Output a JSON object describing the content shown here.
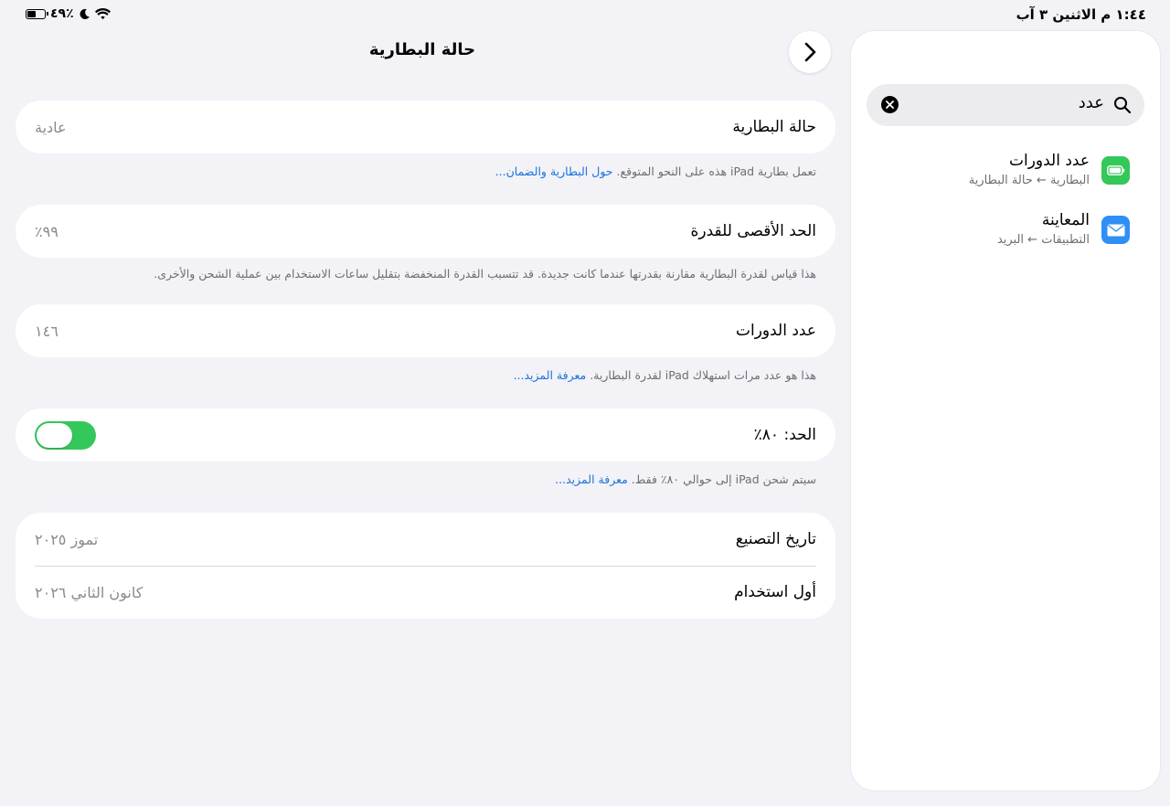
{
  "status_bar": {
    "time_date": "١:٤٤ م   الاثنين ٣ آب",
    "battery_percent": "٤٩٪"
  },
  "detail": {
    "title": "حالة البطارية",
    "battery_health": {
      "label": "حالة البطارية",
      "value": "عادية",
      "footnote": "تعمل بطارية iPad هذه على النحو المتوقع.",
      "footnote_link": "حول البطارية والضمان..."
    },
    "max_capacity": {
      "label": "الحد الأقصى للقدرة",
      "value": "٩٩٪",
      "footnote": "هذا قياس لقدرة البطارية مقارنة بقدرتها عندما كانت جديدة. قد تتسبب القدرة المنخفضة بتقليل ساعات الاستخدام بين عملية الشحن والأخرى."
    },
    "cycle_count": {
      "label": "عدد الدورات",
      "value": "١٤٦",
      "footnote": "هذا هو عدد مرات استهلاك iPad لقدرة البطارية.",
      "footnote_link": "معرفة المزيد..."
    },
    "limit": {
      "label": "الحد: ٨٠٪",
      "toggle_on": true,
      "footnote": "سيتم شحن iPad إلى حوالي ٨٠٪ فقط.",
      "footnote_link": "معرفة المزيد..."
    },
    "manufacture_date": {
      "label": "تاريخ التصنيع",
      "value": "تموز ٢٠٢٥"
    },
    "first_use": {
      "label": "أول استخدام",
      "value": "كانون الثاني ٢٠٢٦"
    }
  },
  "sidebar": {
    "search_value": "عدد",
    "results": [
      {
        "title": "عدد الدورات",
        "path": "البطارية ← حالة البطارية",
        "icon": "battery-settings-icon",
        "icon_color": "#34c759"
      },
      {
        "title": "المعاينة",
        "path": "التطبيقات ← البريد",
        "icon": "mail-icon",
        "icon_color": "#2f8ff5"
      }
    ]
  }
}
